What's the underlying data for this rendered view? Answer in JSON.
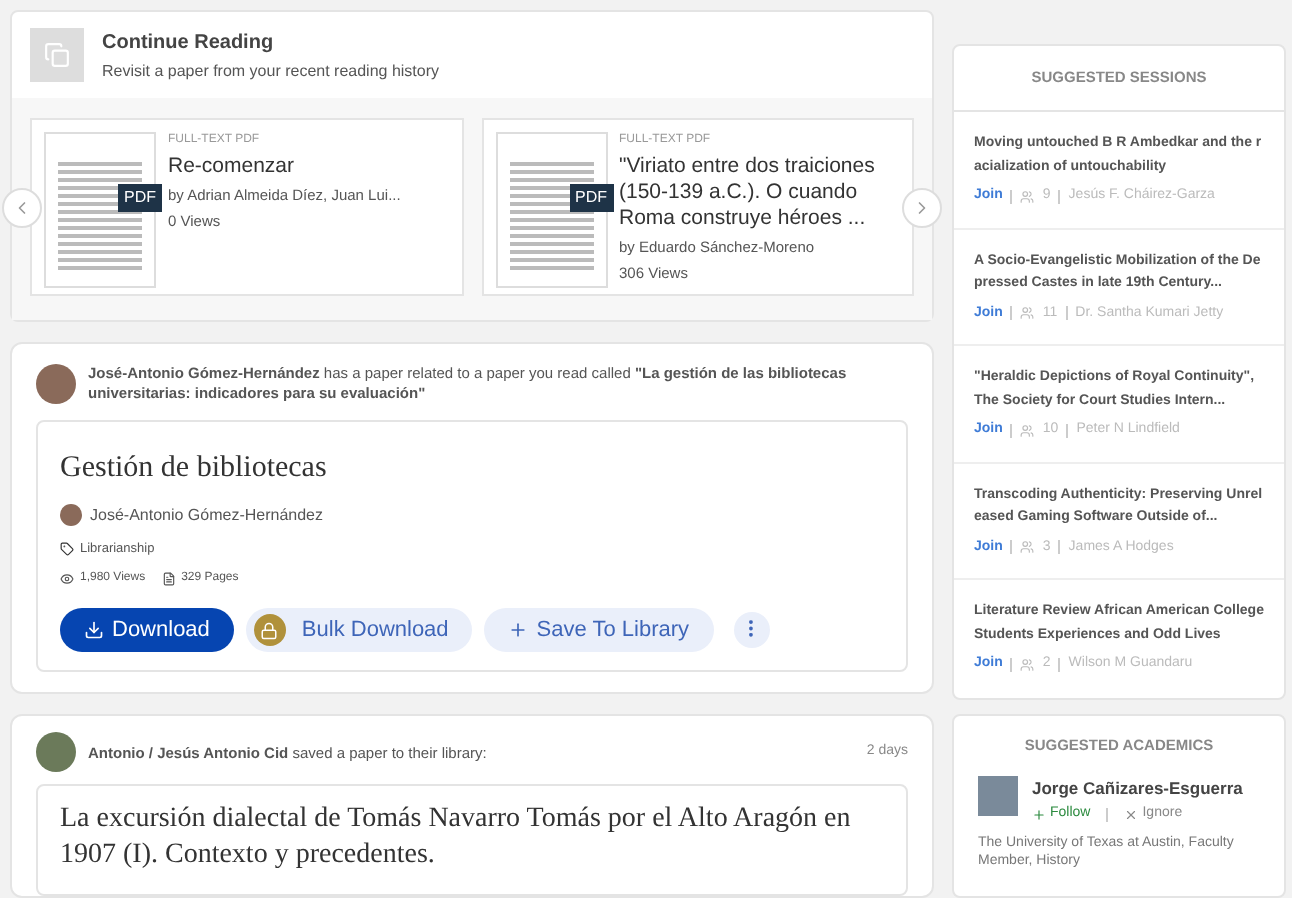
{
  "continue_reading": {
    "title": "Continue Reading",
    "subtitle": "Revisit a paper from your recent reading history",
    "papers": [
      {
        "type": "FULL-TEXT PDF",
        "badge": "PDF",
        "title": "Re-comenzar",
        "authors": "by Adrian Almeida Díez, Juan Lui...",
        "views": "0 Views"
      },
      {
        "type": "FULL-TEXT PDF",
        "badge": "PDF",
        "title": "\"Viriato entre dos traiciones (150-139 a.C.). O cuando Roma construye héroes ...",
        "authors": "by Eduardo Sánchez-Moreno",
        "views": "306 Views"
      }
    ]
  },
  "related": {
    "message": "**José-Antonio Gómez-Hernández** has a paper related to a paper you read called **\"La gestión de las bibliotecas universitarias: indicadores para su evaluación\"**",
    "paper": {
      "title": "Gestión de bibliotecas",
      "author": "José-Antonio Gómez-Hernández",
      "tag": "Librarianship",
      "views": "1,980 Views",
      "pages": "329 Pages"
    },
    "buttons": [
      {
        "kind": "primary",
        "label": "Download"
      },
      {
        "kind": "lock",
        "label": "Bulk Download"
      },
      {
        "kind": "add",
        "label": "Save To Library"
      },
      {
        "kind": "more",
        "label": "⁝"
      }
    ]
  },
  "saved": {
    "message": "**Antonio / Jesús Antonio Cid** saved a paper to their library:",
    "time": "2 days",
    "paper": {
      "title": "La excursión dialectal de Tomás Navarro Tomás por el Alto Aragón en 1907 (I). Contexto y precedentes."
    }
  },
  "suggested_sessions": {
    "title": "SUGGESTED SESSIONS",
    "items": [
      {
        "title": "Moving untouched B R Ambedkar and the racialization of untouchability",
        "action": "Join",
        "count": "9",
        "host": "Jesús F. Cháirez-Garza"
      },
      {
        "title": "A Socio-Evangelistic Mobilization of the Depressed Castes in late 19th Century...",
        "action": "Join",
        "count": "11",
        "host": "Dr. Santha Kumari Jetty"
      },
      {
        "title": "\"Heraldic Depictions of Royal Continuity\", The Society for Court Studies Intern...",
        "action": "Join",
        "count": "10",
        "host": "Peter N Lindfield"
      },
      {
        "title": "Transcoding Authenticity: Preserving Unreleased Gaming Software Outside of...",
        "action": "Join",
        "count": "3",
        "host": "James A Hodges"
      },
      {
        "title": "Literature Review African American College Students Experiences and Odd Lives",
        "action": "Join",
        "count": "2",
        "host": "Wilson M Guandaru"
      }
    ]
  },
  "suggested_academics": {
    "title": "SUGGESTED ACADEMICS",
    "items": [
      {
        "name": "Jorge Cañizares-Esguerra",
        "follow": "Follow",
        "ignore": "Ignore",
        "affiliation": "The University of Texas at Austin, Faculty Member, History"
      }
    ]
  }
}
